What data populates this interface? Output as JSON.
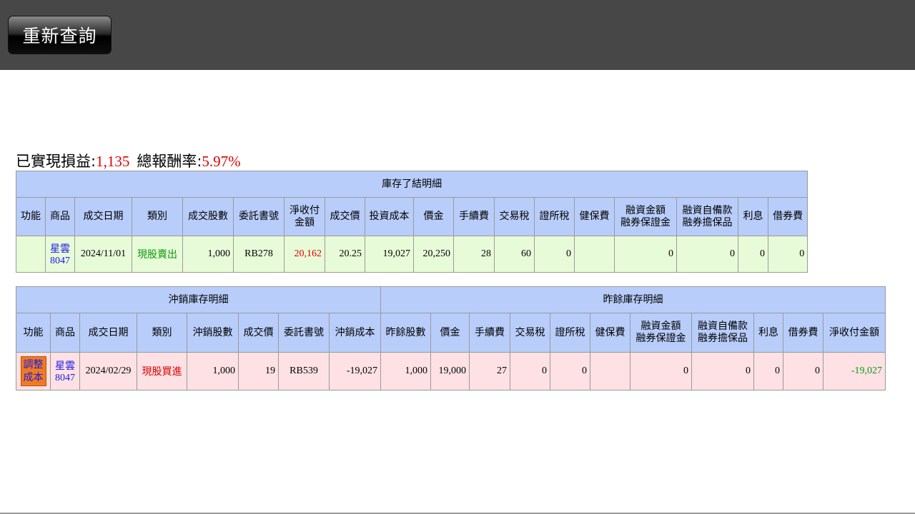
{
  "toolbar": {
    "requery_label": "重新查詢"
  },
  "summary": {
    "realized_label": "已實現損益:",
    "realized_value": "1,135",
    "return_label": "總報酬率:",
    "return_value": "5.97%"
  },
  "closed_detail": {
    "title": "庫存了結明細",
    "headers": [
      "功能",
      "商品",
      "成交日期",
      "類別",
      "成交股數",
      "委託書號",
      "淨收付金額",
      "成交價",
      "投資成本",
      "價金",
      "手續費",
      "交易稅",
      "證所稅",
      "健保費",
      "融資金額融券保證金",
      "融資自備款融券擔保品",
      "利息",
      "借券費"
    ],
    "header_lines": {
      "net": [
        "淨收付",
        "金額"
      ],
      "margin": [
        "融資金額",
        "融券保證金"
      ],
      "self": [
        "融資自備款",
        "融券擔保品"
      ]
    },
    "row": {
      "function": "",
      "product_name": "星雲",
      "product_code": "8047",
      "date": "2024/11/01",
      "type": "現股賣出",
      "shares": "1,000",
      "order_no": "RB278",
      "net_amount": "20,162",
      "price": "20.25",
      "cost": "19,027",
      "amount": "20,250",
      "fee": "28",
      "tax": "60",
      "securities_tax": "0",
      "health_fee": "",
      "margin_amount": "0",
      "self_fund": "0",
      "interest": "0",
      "lending_fee": "0"
    }
  },
  "offset_detail": {
    "left_title": "沖銷庫存明細",
    "right_title": "昨餘庫存明細",
    "headers": [
      "功能",
      "商品",
      "成交日期",
      "類別",
      "沖銷股數",
      "成交價",
      "委託書號",
      "沖銷成本",
      "昨餘股數",
      "價金",
      "手續費",
      "交易稅",
      "證所稅",
      "健保費",
      "融資金額融券保證金",
      "融資自備款融券擔保品",
      "利息",
      "借券費",
      "淨收付金額"
    ],
    "header_lines": {
      "margin": [
        "融資金額",
        "融券保證金"
      ],
      "self": [
        "融資自備款",
        "融券擔保品"
      ]
    },
    "row": {
      "function_label": "調整成本",
      "function_lines": [
        "調整",
        "成本"
      ],
      "product_name": "星雲",
      "product_code": "8047",
      "date": "2024/02/29",
      "type": "現股買進",
      "offset_shares": "1,000",
      "price": "19",
      "order_no": "RB539",
      "offset_cost": "-19,027",
      "remaining_shares": "1,000",
      "amount": "19,000",
      "fee": "27",
      "tax": "0",
      "securities_tax": "0",
      "health_fee": "",
      "margin_amount": "0",
      "self_fund": "0",
      "interest": "0",
      "lending_fee": "0",
      "net_amount": "-19,027"
    }
  },
  "colors": {
    "header_bg": "#b8cdfa",
    "closed_row_bg": "#e8fbd8",
    "offset_row_bg": "#fde1e4",
    "profit_red": "#e00000",
    "loss_green": "#0b9a0b",
    "link_blue": "#1a1ae6",
    "adjust_button": "#f07a22"
  }
}
